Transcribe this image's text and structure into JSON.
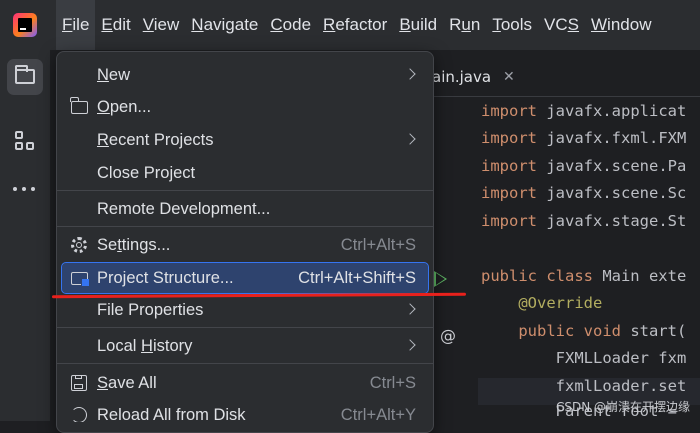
{
  "menubar": {
    "items": [
      {
        "pre": "",
        "mn": "F",
        "post": "ile"
      },
      {
        "pre": "",
        "mn": "E",
        "post": "dit"
      },
      {
        "pre": "",
        "mn": "V",
        "post": "iew"
      },
      {
        "pre": "",
        "mn": "N",
        "post": "avigate"
      },
      {
        "pre": "",
        "mn": "C",
        "post": "ode"
      },
      {
        "pre": "",
        "mn": "R",
        "post": "efactor"
      },
      {
        "pre": "",
        "mn": "B",
        "post": "uild"
      },
      {
        "pre": "R",
        "mn": "u",
        "post": "n"
      },
      {
        "pre": "",
        "mn": "T",
        "post": "ools"
      },
      {
        "pre": "VC",
        "mn": "S",
        "post": ""
      },
      {
        "pre": "",
        "mn": "W",
        "post": "indow"
      }
    ]
  },
  "editor": {
    "tab_label": "ain.java",
    "tab_close": "✕",
    "code_lines": [
      {
        "kw": "import",
        "rest": " javafx.applicat"
      },
      {
        "kw": "import",
        "rest": " javafx.fxml.FXM"
      },
      {
        "kw": "import",
        "rest": " javafx.scene.Pa"
      },
      {
        "kw": "import",
        "rest": " javafx.scene.Sc"
      },
      {
        "kw": "import",
        "rest": " javafx.stage.St"
      },
      {
        "kw": "",
        "rest": ""
      },
      {
        "kw": "public class",
        "rest": " Main exte"
      },
      {
        "kw": "",
        "anno": "    @Override",
        "rest": ""
      },
      {
        "kw": "    public void",
        "rest": " start("
      },
      {
        "kw": "",
        "rest": "        FXMLLoader fxm"
      },
      {
        "kw": "",
        "rest": "        fxmlLoader.set"
      },
      {
        "kw": "",
        "rest": "        Parent root ="
      }
    ],
    "gutter_at": "@"
  },
  "file_menu": {
    "new": {
      "pre": "",
      "mn": "N",
      "post": "ew"
    },
    "open": {
      "pre": "",
      "mn": "O",
      "post": "pen..."
    },
    "recent": {
      "pre": "",
      "mn": "R",
      "post": "ecent Projects"
    },
    "close": {
      "pre": "Close Project",
      "mn": "",
      "post": ""
    },
    "remote": {
      "pre": "Remote Development...",
      "mn": "",
      "post": ""
    },
    "settings": {
      "pre": "Se",
      "mn": "t",
      "post": "tings...",
      "shortcut": "Ctrl+Alt+S"
    },
    "structure": {
      "pre": "Project Structure...",
      "mn": "",
      "post": "",
      "shortcut": "Ctrl+Alt+Shift+S"
    },
    "file_props": {
      "pre": "File Properties",
      "mn": "",
      "post": ""
    },
    "local_history": {
      "pre": "Local ",
      "mn": "H",
      "post": "istory"
    },
    "save_all": {
      "pre": "",
      "mn": "S",
      "post": "ave All",
      "shortcut": "Ctrl+S"
    },
    "reload": {
      "pre": "Reload All from Disk",
      "mn": "",
      "post": "",
      "shortcut": "Ctrl+Alt+Y"
    }
  },
  "watermark": "CSDN @崩溃在开摆边缘",
  "colors": {
    "accent": "#3574f0",
    "highlight_bg": "#2e436e",
    "annotation_red": "#e8211c"
  }
}
